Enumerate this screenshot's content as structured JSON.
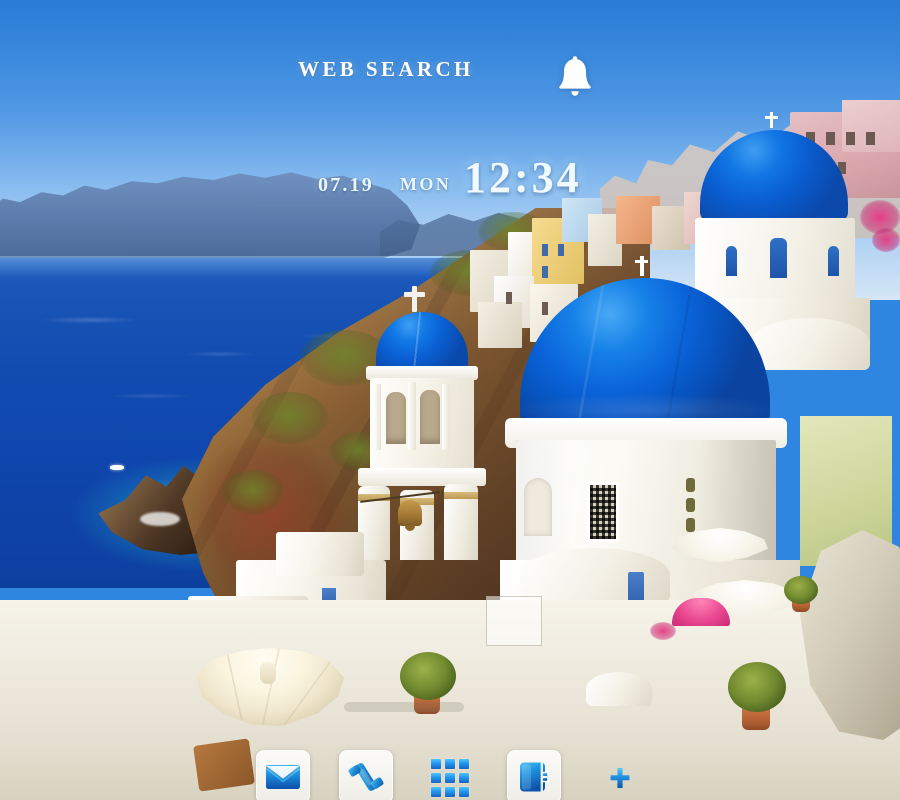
{
  "wallpaper": {
    "scene_name": "santorini-oia-blue-domes",
    "sky_top_color": "#2b80dd",
    "sky_bottom_color": "#d5e6f7",
    "sea_color": "#114ab0",
    "dome_color": "#0a63d8",
    "cliff_color": "#8d6336",
    "building_color": "#ffffff"
  },
  "widgets": {
    "web_search": {
      "label": "WEB SEARCH",
      "name": "web-search-widget"
    },
    "notification_bell": {
      "icon": "bell-icon",
      "color": "#ffffff"
    },
    "clock": {
      "date": "07.19",
      "day_of_week": "MON",
      "time": "12:34",
      "color": "#f1fbff"
    }
  },
  "dock": {
    "items": [
      {
        "name": "mail",
        "label": "Mail",
        "icon": "envelope-icon",
        "has_tile": true
      },
      {
        "name": "phone",
        "label": "Phone",
        "icon": "phone-handset-icon",
        "has_tile": true
      },
      {
        "name": "app-drawer",
        "label": "Apps",
        "icon": "grid-3x3-icon",
        "has_tile": false
      },
      {
        "name": "contacts",
        "label": "Contacts",
        "icon": "address-book-icon",
        "has_tile": true
      },
      {
        "name": "add-shortcut",
        "label": "Add",
        "icon": "plus-icon",
        "has_tile": false
      }
    ],
    "icon_accent": "#2196f3"
  }
}
